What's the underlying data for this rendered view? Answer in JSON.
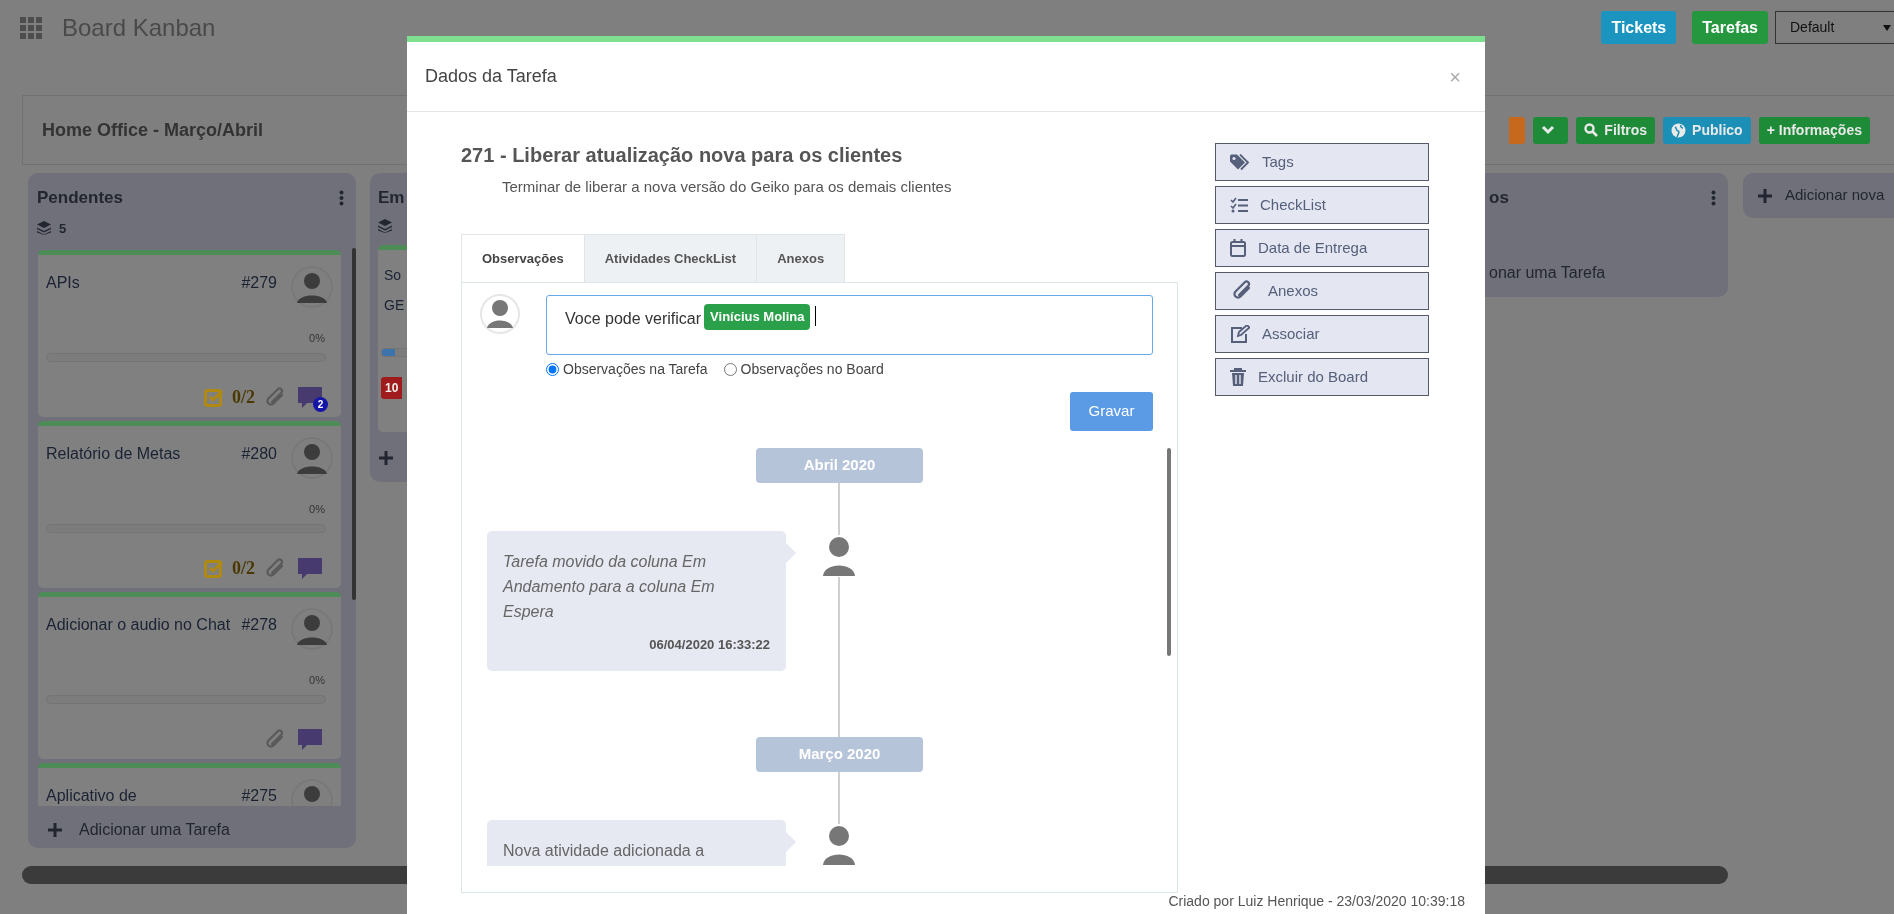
{
  "app": {
    "title": "Board Kanban"
  },
  "header_buttons": [
    {
      "label": "Tickets",
      "kind": "info"
    },
    {
      "label": "Tarefas",
      "kind": "success"
    }
  ],
  "view_select": {
    "value": "Default"
  },
  "board": {
    "title": "Home Office - Março/Abril",
    "toolbar": [
      {
        "kind": "stub"
      },
      {
        "kind": "chevron"
      },
      {
        "kind": "search",
        "label": "Filtros"
      },
      {
        "kind": "globe",
        "label": "Publico"
      },
      {
        "kind": "plain",
        "label": "+ Informações"
      }
    ]
  },
  "columns": [
    {
      "kind": "list",
      "title": "Pendentes",
      "count": "5",
      "add_label": "Adicionar uma Tarefa",
      "cards": [
        {
          "title": "APIs",
          "number": "#279",
          "progress": "0%",
          "level": 0,
          "checklist": "0/2",
          "attachment": true,
          "comment": true,
          "comment_count": "2"
        },
        {
          "title": "Relatório de Metas",
          "number": "#280",
          "progress": "0%",
          "level": 0,
          "checklist": "0/2",
          "attachment": true,
          "comment": true
        },
        {
          "title": "Adicionar o audio no Chat",
          "number": "#278",
          "progress": "0%",
          "level": 0,
          "attachment": true,
          "comment": true
        },
        {
          "title": "Aplicativo de",
          "number": "#275"
        }
      ]
    },
    {
      "kind": "peek",
      "title": "Em",
      "cards": [
        {
          "lines": [
            "So",
            "GE"
          ],
          "level": 0.5,
          "badge": "10"
        }
      ]
    },
    {
      "kind": "tail",
      "title": "os",
      "add_label": "onar uma Tarefa"
    },
    {
      "kind": "new",
      "label": "Adicionar nova"
    }
  ],
  "modal": {
    "title": "Dados da Tarefa",
    "close": "×",
    "task_title": "271 - Liberar atualização nova para os clientes",
    "description": "Terminar de liberar a nova versão do Geiko para os demais clientes",
    "tabs": [
      {
        "label": "Observações",
        "selected": true
      },
      {
        "label": "Atividades CheckList",
        "selected": false
      },
      {
        "label": "Anexos",
        "selected": false
      }
    ],
    "comment_input": {
      "text": "Voce pode verificar",
      "mention": "Vinícius Molina"
    },
    "scopes": [
      {
        "label": "Observações na Tarefa",
        "selected": true
      },
      {
        "label": "Observações no Board",
        "selected": false
      }
    ],
    "save_label": "Gravar",
    "timeline": [
      {
        "kind": "month",
        "label": "Abril 2020"
      },
      {
        "kind": "entry",
        "text": "Tarefa movido da coluna Em Andamento para a coluna Em Espera",
        "italic": true,
        "time": "06/04/2020 16:33:22"
      },
      {
        "kind": "month",
        "label": "Março 2020"
      },
      {
        "kind": "entry",
        "text": "Nova atividade adicionada a",
        "italic": false
      }
    ],
    "actions": [
      {
        "label": "Tags"
      },
      {
        "label": "CheckList"
      },
      {
        "label": "Data de Entrega"
      },
      {
        "label": "Anexos"
      },
      {
        "label": "Associar"
      },
      {
        "label": "Excluir do Board"
      }
    ],
    "footer": "Criado por Luiz Henrique - 23/03/2020 10:39:18"
  }
}
